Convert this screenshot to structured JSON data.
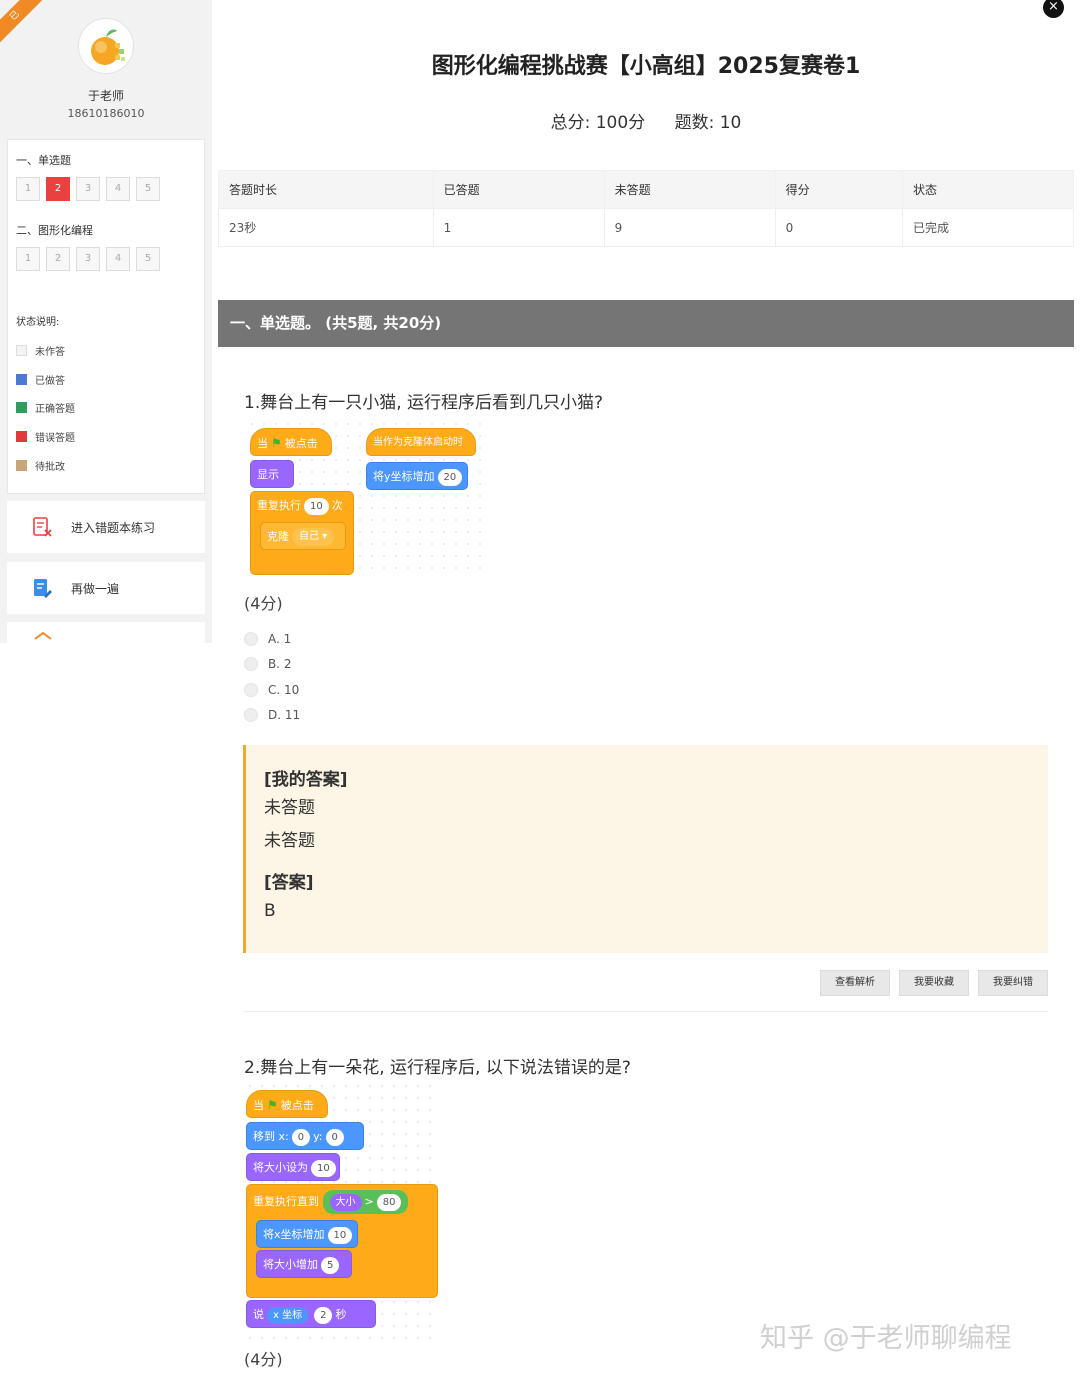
{
  "sidebar": {
    "corner_badge": "已",
    "teacher_name": "于老师",
    "teacher_phone": "18610186010",
    "sections": [
      {
        "title": "一、单选题",
        "questions": [
          "1",
          "2",
          "3",
          "4",
          "5"
        ],
        "wrong_index": 1
      },
      {
        "title": "二、图形化编程",
        "questions": [
          "1",
          "2",
          "3",
          "4",
          "5"
        ]
      }
    ],
    "legend_title": "状态说明:",
    "legend": [
      {
        "label": "未作答",
        "color": "#f4f4f4"
      },
      {
        "label": "已做答",
        "color": "#4a7bd0"
      },
      {
        "label": "正确答题",
        "color": "#2e9e5e"
      },
      {
        "label": "错误答题",
        "color": "#e03a3a"
      },
      {
        "label": "待批改",
        "color": "#c9a57a"
      }
    ],
    "actions": [
      {
        "label": "进入错题本练习",
        "icon": "error-book-icon"
      },
      {
        "label": "再做一遍",
        "icon": "redo-icon"
      }
    ]
  },
  "exam": {
    "title": "图形化编程挑战赛【小高组】2025复赛卷1",
    "total_score": "总分: 100分",
    "question_count": "题数: 10"
  },
  "stats_table": {
    "headers": [
      "答题时长",
      "已答题",
      "未答题",
      "得分",
      "状态"
    ],
    "row": [
      "23秒",
      "1",
      "9",
      "0",
      "已完成"
    ]
  },
  "section_bar": "一、单选题。  (共5题, 共20分)",
  "q1": {
    "text": "1.舞台上有一只小猫, 运行程序后看到几只小猫?",
    "blocks": {
      "when_flag_1": "当",
      "when_flag_2": "被点击",
      "show": "显示",
      "repeat": "重复执行",
      "repeat_count": "10",
      "repeat_unit": "次",
      "clone": "克隆",
      "clone_target": "自己 ▾",
      "clone_hat": "当作为克隆体启动时",
      "change_y": "将y坐标增加",
      "change_y_val": "20"
    },
    "score": "(4分)",
    "options": [
      "A. 1",
      "B. 2",
      "C. 10",
      "D. 11"
    ],
    "my_answer_label": "[我的答案]",
    "my_answer_value1": "未答题",
    "my_answer_value2": "未答题",
    "answer_label": "[答案]",
    "answer_value": "B",
    "buttons": [
      "查看解析",
      "我要收藏",
      "我要纠错"
    ]
  },
  "q2": {
    "text": "2.舞台上有一朵花, 运行程序后, 以下说法错误的是?",
    "blocks": {
      "when_flag_1": "当",
      "when_flag_2": "被点击",
      "goto": "移到 x:",
      "goto_x": "0",
      "goto_y_label": "y:",
      "goto_y": "0",
      "set_size": "将大小设为",
      "set_size_val": "10",
      "repeat_until": "重复执行直到",
      "size": "大小",
      "gt": ">",
      "gt_val": "80",
      "change_x": "将x坐标增加",
      "change_x_val": "10",
      "change_size": "将大小增加",
      "change_size_val": "5",
      "say": "说",
      "x_pos": "x 坐标",
      "say_secs": "2",
      "say_unit": "秒"
    },
    "score": "(4分)"
  },
  "watermark": "知乎 @于老师聊编程",
  "close_icon": "×",
  "colors": {
    "wrong": "#e8413f",
    "section_bar": "#757575",
    "answer_border": "#f0a830",
    "answer_bg": "#fdf5e5"
  }
}
